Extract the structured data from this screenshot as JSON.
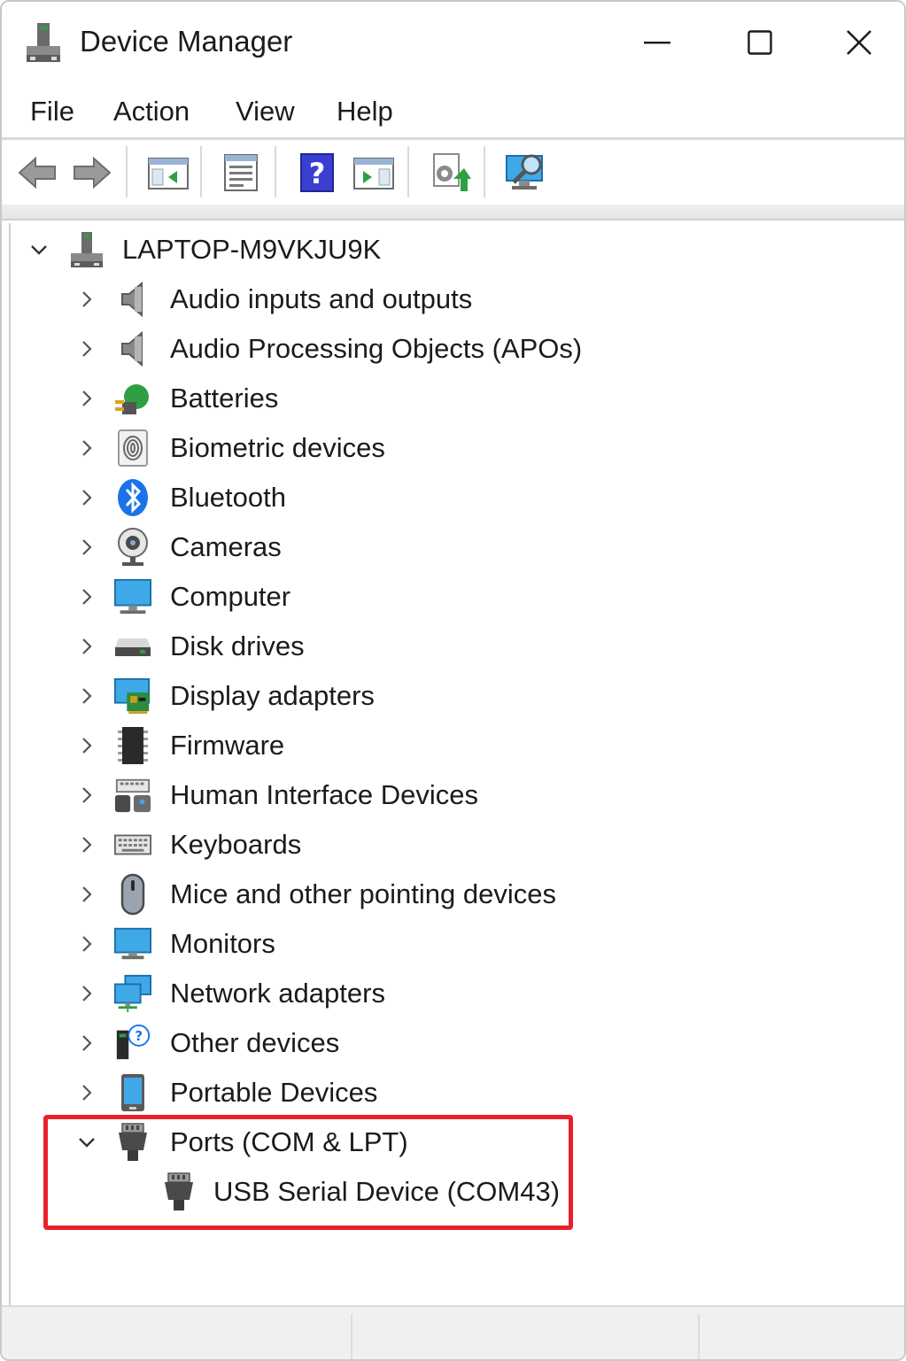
{
  "window": {
    "title": "Device Manager",
    "controls": {
      "minimize": "minimize-icon",
      "maximize": "maximize-icon",
      "close": "close-icon"
    }
  },
  "menu": {
    "items": [
      {
        "label": "File"
      },
      {
        "label": "Action"
      },
      {
        "label": "View"
      },
      {
        "label": "Help"
      }
    ]
  },
  "toolbar": {
    "buttons": [
      {
        "icon": "back-arrow-icon"
      },
      {
        "icon": "forward-arrow-icon"
      },
      {
        "icon": "show-hide-console-tree-icon"
      },
      {
        "icon": "properties-icon"
      },
      {
        "icon": "help-icon"
      },
      {
        "icon": "show-hide-action-pane-icon"
      },
      {
        "icon": "update-driver-icon"
      },
      {
        "icon": "scan-hardware-changes-icon"
      }
    ]
  },
  "tree": {
    "root": {
      "label": "LAPTOP-M9VKJU9K",
      "expanded": true,
      "icon": "computer-network-icon"
    },
    "categories": [
      {
        "label": "Audio inputs and outputs",
        "icon": "speaker-icon",
        "expanded": false
      },
      {
        "label": "Audio Processing Objects (APOs)",
        "icon": "speaker-icon",
        "expanded": false
      },
      {
        "label": "Batteries",
        "icon": "battery-icon",
        "expanded": false
      },
      {
        "label": "Biometric devices",
        "icon": "fingerprint-icon",
        "expanded": false
      },
      {
        "label": "Bluetooth",
        "icon": "bluetooth-icon",
        "expanded": false
      },
      {
        "label": "Cameras",
        "icon": "webcam-icon",
        "expanded": false
      },
      {
        "label": "Computer",
        "icon": "monitor-icon",
        "expanded": false
      },
      {
        "label": "Disk drives",
        "icon": "disk-drive-icon",
        "expanded": false
      },
      {
        "label": "Display adapters",
        "icon": "display-adapter-icon",
        "expanded": false
      },
      {
        "label": "Firmware",
        "icon": "chip-icon",
        "expanded": false
      },
      {
        "label": "Human Interface Devices",
        "icon": "hid-icon",
        "expanded": false
      },
      {
        "label": "Keyboards",
        "icon": "keyboard-icon",
        "expanded": false
      },
      {
        "label": "Mice and other pointing devices",
        "icon": "mouse-icon",
        "expanded": false
      },
      {
        "label": "Monitors",
        "icon": "monitor-icon",
        "expanded": false
      },
      {
        "label": "Network adapters",
        "icon": "network-adapter-icon",
        "expanded": false
      },
      {
        "label": "Other devices",
        "icon": "unknown-device-icon",
        "expanded": false
      },
      {
        "label": "Portable Devices",
        "icon": "portable-device-icon",
        "expanded": false
      },
      {
        "label": "Ports (COM & LPT)",
        "icon": "port-connector-icon",
        "expanded": true,
        "children": [
          {
            "label": "USB Serial Device (COM43)",
            "icon": "port-connector-icon"
          }
        ]
      }
    ]
  },
  "highlight_color": "#e8222c"
}
